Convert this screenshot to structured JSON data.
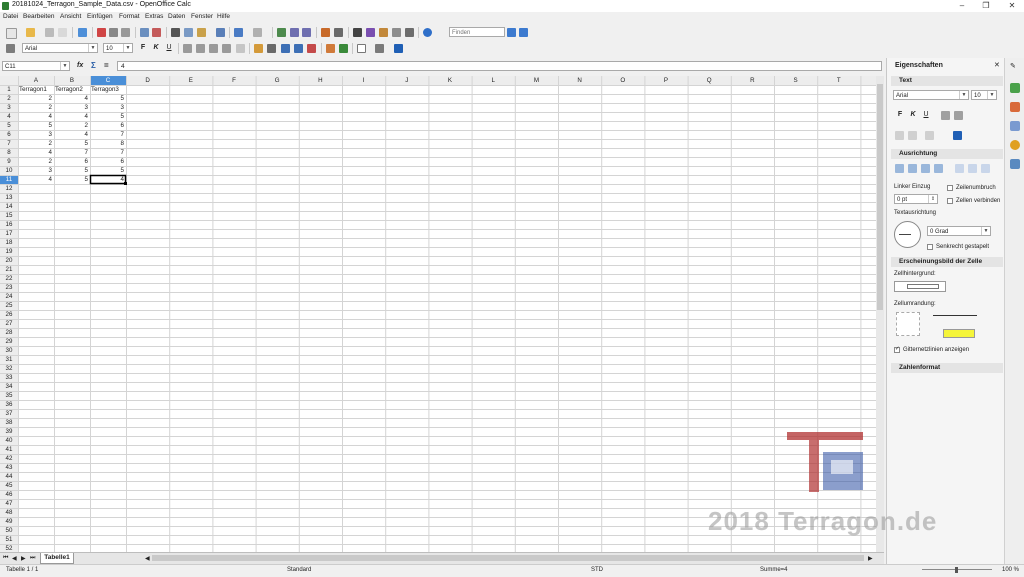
{
  "window": {
    "title": "20181024_Terragon_Sample_Data.csv - OpenOffice Calc",
    "minimize": "–",
    "restore": "❐",
    "close": "✕"
  },
  "menu": [
    "Datei",
    "Bearbeiten",
    "Ansicht",
    "Einfügen",
    "Format",
    "Extras",
    "Daten",
    "Fenster",
    "Hilfe"
  ],
  "toolbar": {
    "find_placeholder": "Finden",
    "font_name": "Arial",
    "font_size": "10",
    "bold": "F",
    "italic": "K",
    "underline": "U"
  },
  "formula_bar": {
    "cell_ref": "C11",
    "func_icon": "fx",
    "sum_icon": "Σ",
    "equals_icon": "=",
    "content": "4"
  },
  "sheet": {
    "columns": [
      "A",
      "B",
      "C",
      "D",
      "E",
      "F",
      "G",
      "H",
      "I",
      "J",
      "K",
      "L",
      "M",
      "N",
      "O",
      "P",
      "Q",
      "R",
      "S",
      "T"
    ],
    "row_count": 52,
    "selected_cell": "C11",
    "headers": [
      "Terragon1",
      "Terragon2",
      "Terragon3"
    ],
    "rows": [
      [
        "2",
        "4",
        "5"
      ],
      [
        "2",
        "3",
        "3"
      ],
      [
        "4",
        "4",
        "5"
      ],
      [
        "5",
        "2",
        "6"
      ],
      [
        "3",
        "4",
        "7"
      ],
      [
        "2",
        "5",
        "8"
      ],
      [
        "4",
        "7",
        "7"
      ],
      [
        "2",
        "6",
        "6"
      ],
      [
        "3",
        "5",
        "5"
      ],
      [
        "4",
        "5",
        "4"
      ]
    ],
    "tab_name": "Tabelle1"
  },
  "status": {
    "sheet": "Tabelle 1 / 1",
    "style": "Standard",
    "mode": "STD",
    "sum": "Summe=4",
    "zoom": "100 %"
  },
  "sidebar": {
    "title": "Eigenschaften",
    "close": "✕",
    "text_section": "Text",
    "font_name": "Arial",
    "font_size": "10",
    "bold": "F",
    "italic": "K",
    "underline": "U",
    "align_section": "Ausrichtung",
    "indent_label": "Linker Einzug",
    "indent_value": "0 pt",
    "wrap_label": "Zeilenumbruch",
    "merge_label": "Zellen verbinden",
    "text_orientation_label": "Textausrichtung",
    "degree_value": "0 Grad",
    "vertical_stacked_label": "Senkrecht gestapelt",
    "appearance_section": "Erscheinungsbild der Zelle",
    "cell_bg_label": "Zellhintergrund:",
    "cell_border_label": "Zellumrandung:",
    "gridlines_label": "Gitternetzlinien anzeigen",
    "number_format_section": "Zahlenformat"
  },
  "watermark": {
    "logo": "TG",
    "text": "2018 Terragon.de"
  },
  "colors": {
    "selection": "#1f74d0",
    "highlight_header": "#4a8fd8",
    "gridline": "#d4d4d4",
    "header_bg": "#ededed",
    "watermark_red": "#b03030",
    "watermark_blue": "#2c4fa3"
  }
}
